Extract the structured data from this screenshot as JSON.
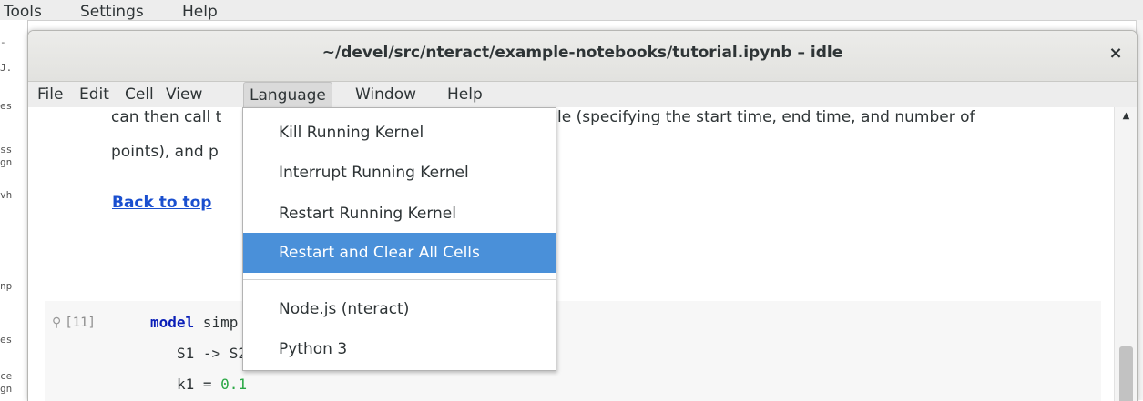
{
  "background_app": {
    "menu": [
      "Tools",
      "Settings",
      "Help"
    ],
    "strip_fragments": [
      "-",
      "J.",
      "es",
      "ss",
      "gn",
      "vh",
      "np",
      "es",
      "ce",
      "gn"
    ]
  },
  "window": {
    "title": "~/devel/src/nteract/example-notebooks/tutorial.ipynb – idle",
    "close_glyph": "×"
  },
  "menubar": {
    "items": [
      "File",
      "Edit",
      "Cell",
      "View",
      "Language",
      "Window",
      "Help"
    ],
    "active": "Language"
  },
  "notebook": {
    "markdown_line1": "can then call t",
    "markdown_line1_right": "le (specifying the start time, end time, and number of",
    "markdown_line2": "points), and p",
    "back_link": "Back to top",
    "cell_prompt": "[11]",
    "code_line1_keyword": "model",
    "code_line1_rest": " simp",
    "code_line2": "S1 -> S2",
    "code_line3_prefix": "k1 = ",
    "code_line3_number": "0.1"
  },
  "language_menu": {
    "items": [
      "Kill Running Kernel",
      "Interrupt Running Kernel",
      "Restart Running Kernel",
      "Restart and Clear All Cells",
      "Node.js (nteract)",
      "Python 3"
    ],
    "highlighted": "Restart and Clear All Cells"
  },
  "colors": {
    "highlight": "#4a90d9",
    "link": "#1a4fcf",
    "keyword": "#0a1fb8",
    "number": "#2aa845"
  },
  "icons": {
    "close": "close-icon",
    "pin": "pin-icon",
    "scroll_up": "scroll-up-arrow-icon"
  }
}
